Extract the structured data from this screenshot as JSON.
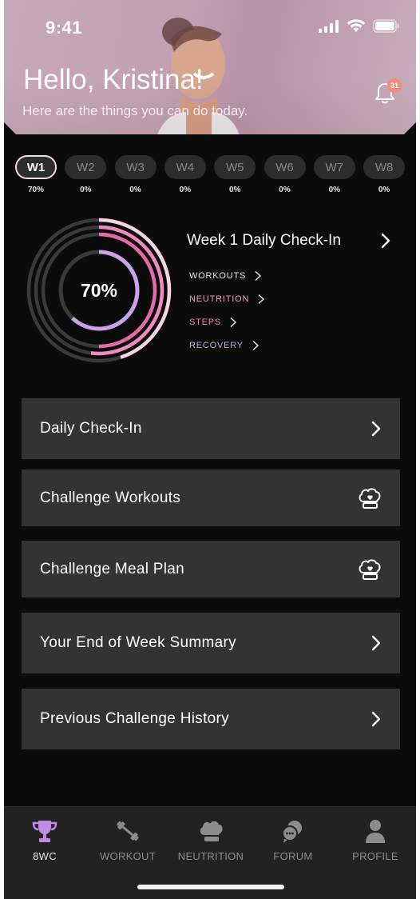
{
  "status_bar": {
    "time": "9:41"
  },
  "header": {
    "greeting": "Hello, Kristina!",
    "subtitle": "Here are the things you can do today.",
    "notification_count": "31"
  },
  "weeks": [
    {
      "label": "W1",
      "percent": "70%",
      "active": true
    },
    {
      "label": "W2",
      "percent": "0%",
      "active": false
    },
    {
      "label": "W3",
      "percent": "0%",
      "active": false
    },
    {
      "label": "W4",
      "percent": "0%",
      "active": false
    },
    {
      "label": "W5",
      "percent": "0%",
      "active": false
    },
    {
      "label": "W6",
      "percent": "0%",
      "active": false
    },
    {
      "label": "W7",
      "percent": "0%",
      "active": false
    },
    {
      "label": "W8",
      "percent": "0%",
      "active": false
    }
  ],
  "progress": {
    "overall_label": "70%",
    "rings": [
      {
        "name": "WORKOUTS",
        "fraction": 0.45,
        "color": "#f6d5e3"
      },
      {
        "name": "NEUTRITION",
        "fraction": 0.52,
        "color": "#f08bc0"
      },
      {
        "name": "STEPS",
        "fraction": 0.5,
        "color": "#e66aa9"
      },
      {
        "name": "RECOVERY",
        "fraction": 0.62,
        "color": "#c9a3e8"
      }
    ]
  },
  "checkin": {
    "title": "Week 1 Daily Check-In",
    "categories": [
      {
        "label": "WORKOUTS",
        "color": "#e8e8e8"
      },
      {
        "label": "NEUTRITION",
        "color": "#f29ac5"
      },
      {
        "label": "STEPS",
        "color": "#ef7fb6"
      },
      {
        "label": "RECOVERY",
        "color": "#c9a3e8"
      }
    ]
  },
  "menu": [
    {
      "label": "Daily Check-In",
      "icon": "chevron-right-icon"
    },
    {
      "label": "Challenge Workouts",
      "icon": "chef-hat-heart-icon"
    },
    {
      "label": "Challenge Meal Plan",
      "icon": "chef-hat-heart-icon"
    },
    {
      "label": "Your End of Week Summary",
      "icon": "chevron-right-icon"
    },
    {
      "label": "Previous Challenge History",
      "icon": "chevron-right-icon"
    }
  ],
  "nav": [
    {
      "label": "8WC",
      "icon": "trophy-icon",
      "active": true
    },
    {
      "label": "WORKOUT",
      "icon": "dumbbell-icon",
      "active": false
    },
    {
      "label": "NEUTRITION",
      "icon": "chef-hat-icon",
      "active": false
    },
    {
      "label": "FORUM",
      "icon": "chat-bubbles-icon",
      "active": false
    },
    {
      "label": "PROFILE",
      "icon": "person-icon",
      "active": false
    }
  ],
  "colors": {
    "background": "#0b0b0b",
    "card": "#333333",
    "accent_pink": "#f08bc0",
    "accent_purple": "#c9a3e8",
    "badge": "#ef8f7a"
  }
}
